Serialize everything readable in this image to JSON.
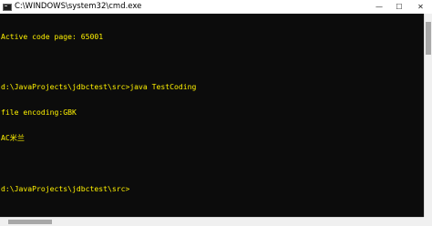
{
  "window": {
    "title": "C:\\WINDOWS\\system32\\cmd.exe",
    "app_icon": "cmd-icon",
    "controls": {
      "minimize_glyph": "—",
      "maximize_glyph": "☐",
      "close_glyph": "✕"
    }
  },
  "console": {
    "text_color": "#fff200",
    "background_color": "#0c0c0c",
    "lines": [
      "Active code page: 65001",
      "",
      "d:\\JavaProjects\\jdbctest\\src>java TestCoding",
      "file encoding:GBK",
      "AC米兰",
      "",
      "d:\\JavaProjects\\jdbctest\\src>"
    ]
  }
}
